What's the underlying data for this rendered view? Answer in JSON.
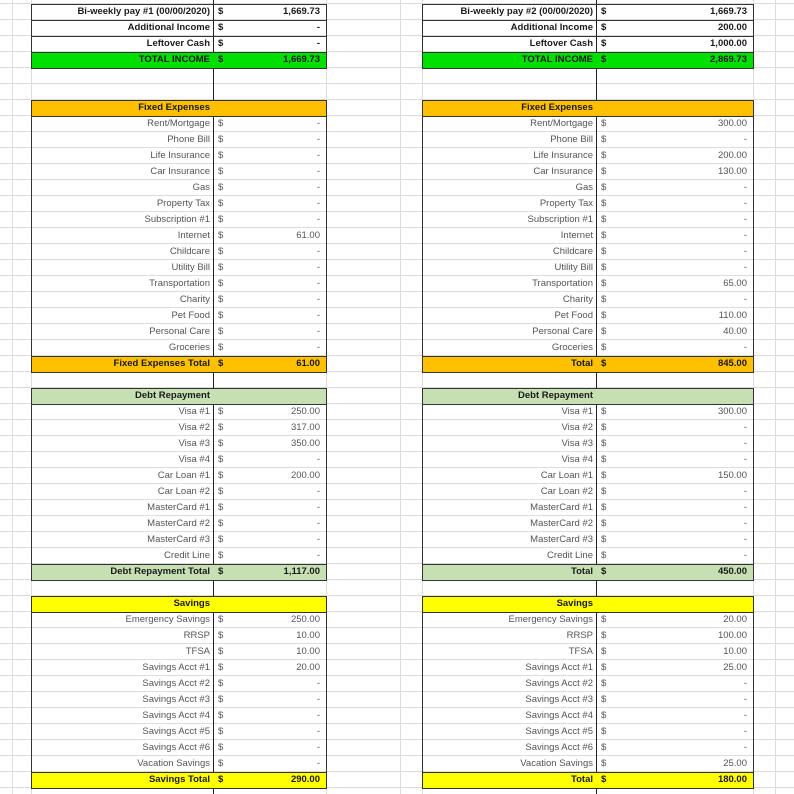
{
  "colors": {
    "total_income": "#00e000",
    "fixed": "#ffc000",
    "debt": "#c6e0b4",
    "savings": "#ffff00"
  },
  "blocks": [
    {
      "income": [
        {
          "label": "Bi-weekly pay #1 (00/00/2020)",
          "currency": "$",
          "value": "1,669.73"
        },
        {
          "label": "Additional Income",
          "currency": "$",
          "value": "-"
        },
        {
          "label": "Leftover Cash",
          "currency": "$",
          "value": "-"
        }
      ],
      "total_income": {
        "label": "TOTAL INCOME",
        "currency": "$",
        "value": "1,669.73"
      },
      "fixed": {
        "header": "Fixed Expenses",
        "items": [
          {
            "label": "Rent/Mortgage",
            "currency": "$",
            "value": "-"
          },
          {
            "label": "Phone Bill",
            "currency": "$",
            "value": "-"
          },
          {
            "label": "Life Insurance",
            "currency": "$",
            "value": "-"
          },
          {
            "label": "Car Insurance",
            "currency": "$",
            "value": "-"
          },
          {
            "label": "Gas",
            "currency": "$",
            "value": "-"
          },
          {
            "label": "Property Tax",
            "currency": "$",
            "value": "-"
          },
          {
            "label": "Subscription #1",
            "currency": "$",
            "value": "-"
          },
          {
            "label": "Internet",
            "currency": "$",
            "value": "61.00"
          },
          {
            "label": "Childcare",
            "currency": "$",
            "value": "-"
          },
          {
            "label": "Utility Bill",
            "currency": "$",
            "value": "-"
          },
          {
            "label": "Transportation",
            "currency": "$",
            "value": "-"
          },
          {
            "label": "Charity",
            "currency": "$",
            "value": "-"
          },
          {
            "label": "Pet Food",
            "currency": "$",
            "value": "-"
          },
          {
            "label": "Personal Care",
            "currency": "$",
            "value": "-"
          },
          {
            "label": "Groceries",
            "currency": "$",
            "value": "-"
          }
        ],
        "total": {
          "label": "Fixed Expenses Total",
          "currency": "$",
          "value": "61.00"
        }
      },
      "debt": {
        "header": "Debt Repayment",
        "items": [
          {
            "label": "Visa #1",
            "currency": "$",
            "value": "250.00"
          },
          {
            "label": "Visa #2",
            "currency": "$",
            "value": "317.00"
          },
          {
            "label": "Visa #3",
            "currency": "$",
            "value": "350.00"
          },
          {
            "label": "Visa #4",
            "currency": "$",
            "value": "-"
          },
          {
            "label": "Car Loan #1",
            "currency": "$",
            "value": "200.00"
          },
          {
            "label": "Car Loan #2",
            "currency": "$",
            "value": "-"
          },
          {
            "label": "MasterCard #1",
            "currency": "$",
            "value": "-"
          },
          {
            "label": "MasterCard #2",
            "currency": "$",
            "value": "-"
          },
          {
            "label": "MasterCard #3",
            "currency": "$",
            "value": "-"
          },
          {
            "label": "Credit Line",
            "currency": "$",
            "value": "-"
          }
        ],
        "total": {
          "label": "Debt Repayment Total",
          "currency": "$",
          "value": "1,117.00"
        }
      },
      "savings": {
        "header": "Savings",
        "items": [
          {
            "label": "Emergency Savings",
            "currency": "$",
            "value": "250.00"
          },
          {
            "label": "RRSP",
            "currency": "$",
            "value": "10.00"
          },
          {
            "label": "TFSA",
            "currency": "$",
            "value": "10.00"
          },
          {
            "label": "Savings Acct #1",
            "currency": "$",
            "value": "20.00"
          },
          {
            "label": "Savings Acct #2",
            "currency": "$",
            "value": "-"
          },
          {
            "label": "Savings Acct #3",
            "currency": "$",
            "value": "-"
          },
          {
            "label": "Savings Acct #4",
            "currency": "$",
            "value": "-"
          },
          {
            "label": "Savings Acct #5",
            "currency": "$",
            "value": "-"
          },
          {
            "label": "Savings Acct #6",
            "currency": "$",
            "value": "-"
          },
          {
            "label": "Vacation Savings",
            "currency": "$",
            "value": "-"
          }
        ],
        "total": {
          "label": "Savings Total",
          "currency": "$",
          "value": "290.00"
        }
      }
    },
    {
      "income": [
        {
          "label": "Bi-weekly pay #2 (00/00/2020)",
          "currency": "$",
          "value": "1,669.73"
        },
        {
          "label": "Additional Income",
          "currency": "$",
          "value": "200.00"
        },
        {
          "label": "Leftover Cash",
          "currency": "$",
          "value": "1,000.00"
        }
      ],
      "total_income": {
        "label": "TOTAL INCOME",
        "currency": "$",
        "value": "2,869.73"
      },
      "fixed": {
        "header": "Fixed Expenses",
        "items": [
          {
            "label": "Rent/Mortgage",
            "currency": "$",
            "value": "300.00"
          },
          {
            "label": "Phone Bill",
            "currency": "$",
            "value": "-"
          },
          {
            "label": "Life Insurance",
            "currency": "$",
            "value": "200.00"
          },
          {
            "label": "Car Insurance",
            "currency": "$",
            "value": "130.00"
          },
          {
            "label": "Gas",
            "currency": "$",
            "value": "-"
          },
          {
            "label": "Property Tax",
            "currency": "$",
            "value": "-"
          },
          {
            "label": "Subscription #1",
            "currency": "$",
            "value": "-"
          },
          {
            "label": "Internet",
            "currency": "$",
            "value": "-"
          },
          {
            "label": "Childcare",
            "currency": "$",
            "value": "-"
          },
          {
            "label": "Utility Bill",
            "currency": "$",
            "value": "-"
          },
          {
            "label": "Transportation",
            "currency": "$",
            "value": "65.00"
          },
          {
            "label": "Charity",
            "currency": "$",
            "value": "-"
          },
          {
            "label": "Pet Food",
            "currency": "$",
            "value": "110.00"
          },
          {
            "label": "Personal Care",
            "currency": "$",
            "value": "40.00"
          },
          {
            "label": "Groceries",
            "currency": "$",
            "value": "-"
          }
        ],
        "total": {
          "label": "Total",
          "currency": "$",
          "value": "845.00"
        }
      },
      "debt": {
        "header": "Debt Repayment",
        "items": [
          {
            "label": "Visa #1",
            "currency": "$",
            "value": "300.00"
          },
          {
            "label": "Visa #2",
            "currency": "$",
            "value": "-"
          },
          {
            "label": "Visa #3",
            "currency": "$",
            "value": "-"
          },
          {
            "label": "Visa #4",
            "currency": "$",
            "value": "-"
          },
          {
            "label": "Car Loan #1",
            "currency": "$",
            "value": "150.00"
          },
          {
            "label": "Car Loan #2",
            "currency": "$",
            "value": "-"
          },
          {
            "label": "MasterCard #1",
            "currency": "$",
            "value": "-"
          },
          {
            "label": "MasterCard #2",
            "currency": "$",
            "value": "-"
          },
          {
            "label": "MasterCard #3",
            "currency": "$",
            "value": "-"
          },
          {
            "label": "Credit Line",
            "currency": "$",
            "value": "-"
          }
        ],
        "total": {
          "label": "Total",
          "currency": "$",
          "value": "450.00"
        }
      },
      "savings": {
        "header": "Savings",
        "items": [
          {
            "label": "Emergency Savings",
            "currency": "$",
            "value": "20.00"
          },
          {
            "label": "RRSP",
            "currency": "$",
            "value": "100.00"
          },
          {
            "label": "TFSA",
            "currency": "$",
            "value": "10.00"
          },
          {
            "label": "Savings Acct #1",
            "currency": "$",
            "value": "25.00"
          },
          {
            "label": "Savings Acct #2",
            "currency": "$",
            "value": "-"
          },
          {
            "label": "Savings Acct #3",
            "currency": "$",
            "value": "-"
          },
          {
            "label": "Savings Acct #4",
            "currency": "$",
            "value": "-"
          },
          {
            "label": "Savings Acct #5",
            "currency": "$",
            "value": "-"
          },
          {
            "label": "Savings Acct #6",
            "currency": "$",
            "value": "-"
          },
          {
            "label": "Vacation Savings",
            "currency": "$",
            "value": "25.00"
          }
        ],
        "total": {
          "label": "Total",
          "currency": "$",
          "value": "180.00"
        }
      }
    }
  ]
}
